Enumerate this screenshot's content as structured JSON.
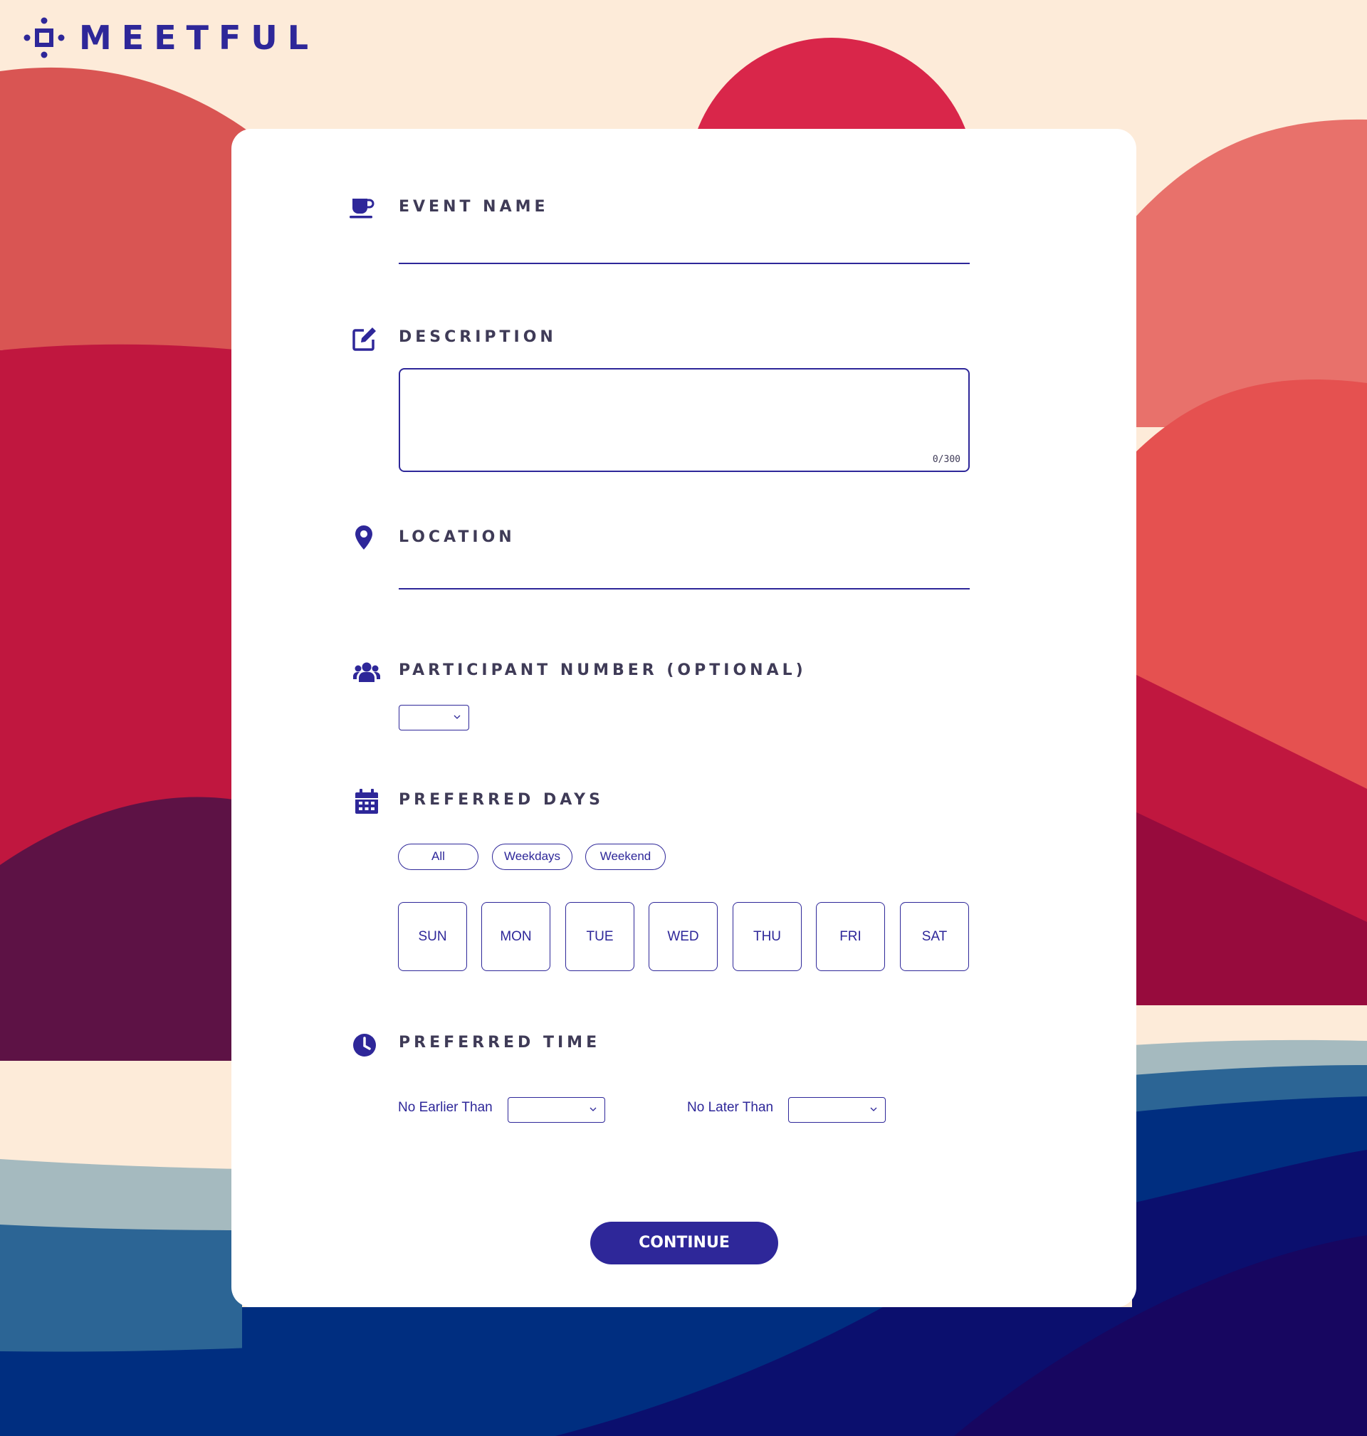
{
  "brand": {
    "name": "MEETFUL",
    "logo_icon": "meetful-logo-icon",
    "color": "#2e2799"
  },
  "form": {
    "event_name": {
      "label": "EVENT NAME",
      "icon": "coffee-cup-icon",
      "value": ""
    },
    "description": {
      "label": "DESCRIPTION",
      "icon": "edit-icon",
      "value": "",
      "char_count": "0/300"
    },
    "location": {
      "label": "LOCATION",
      "icon": "map-pin-icon",
      "value": ""
    },
    "participant_number": {
      "label": "PARTICIPANT NUMBER (OPTIONAL)",
      "icon": "users-icon",
      "selected": ""
    },
    "preferred_days": {
      "label": "PREFERRED DAYS",
      "icon": "calendar-icon",
      "presets": [
        "All",
        "Weekdays",
        "Weekend"
      ],
      "days": [
        "SUN",
        "MON",
        "TUE",
        "WED",
        "THU",
        "FRI",
        "SAT"
      ]
    },
    "preferred_time": {
      "label": "PREFERRED TIME",
      "icon": "clock-icon",
      "no_earlier_than": {
        "label": "No Earlier Than",
        "selected": ""
      },
      "no_later_than": {
        "label": "No Later Than",
        "selected": ""
      }
    },
    "continue_label": "CONTINUE"
  },
  "colors": {
    "accent": "#2e2799",
    "label_text": "#3f3b57",
    "background": "#fdebd9",
    "card": "#ffffff"
  }
}
